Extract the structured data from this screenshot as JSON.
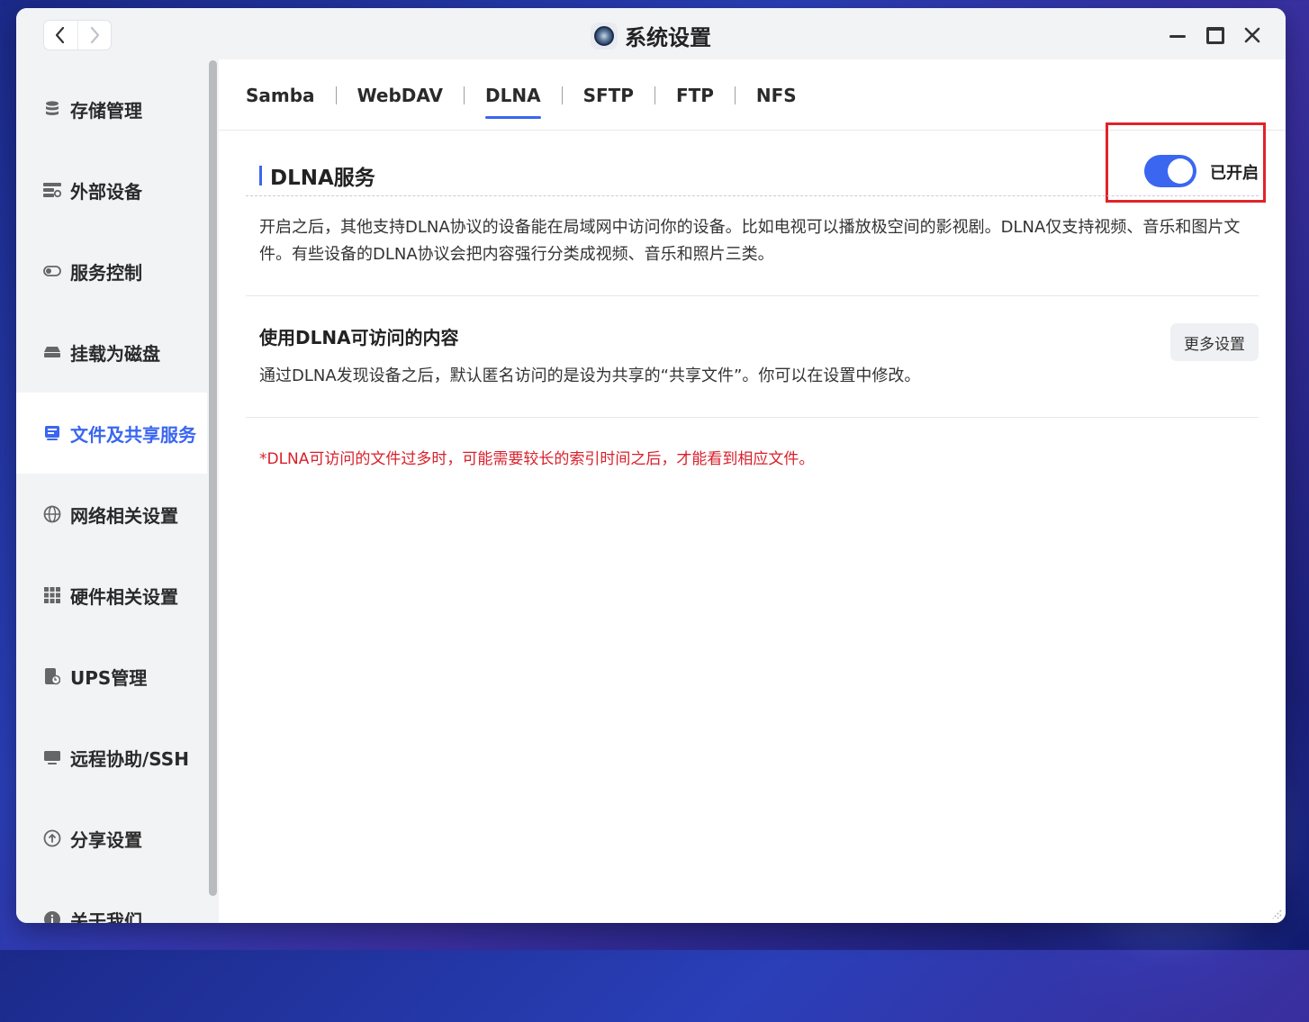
{
  "window": {
    "title": "系统设置"
  },
  "nav": {
    "back_icon": "chevron-left-icon",
    "forward_icon": "chevron-right-icon"
  },
  "sidebar": {
    "items": [
      {
        "label": "存储管理",
        "icon": "database-icon"
      },
      {
        "label": "外部设备",
        "icon": "device-icon"
      },
      {
        "label": "服务控制",
        "icon": "toggle-icon"
      },
      {
        "label": "挂载为磁盘",
        "icon": "drive-icon"
      },
      {
        "label": "文件及共享服务",
        "icon": "file-share-icon",
        "active": true
      },
      {
        "label": "网络相关设置",
        "icon": "globe-icon"
      },
      {
        "label": "硬件相关设置",
        "icon": "grid-icon"
      },
      {
        "label": "UPS管理",
        "icon": "ups-icon"
      },
      {
        "label": "远程协助/SSH",
        "icon": "monitor-icon"
      },
      {
        "label": "分享设置",
        "icon": "share-icon"
      },
      {
        "label": "关于我们",
        "icon": "info-icon"
      }
    ]
  },
  "tabs": [
    {
      "label": "Samba"
    },
    {
      "label": "WebDAV"
    },
    {
      "label": "DLNA",
      "active": true
    },
    {
      "label": "SFTP"
    },
    {
      "label": "FTP"
    },
    {
      "label": "NFS"
    }
  ],
  "dlna": {
    "title": "DLNA服务",
    "toggle_state": "已开启",
    "toggle_on": true,
    "description": "开启之后，其他支持DLNA协议的设备能在局域网中访问你的设备。比如电视可以播放极空间的影视剧。DLNA仅支持视频、音乐和图片文件。有些设备的DLNA协议会把内容强行分类成视频、音乐和照片三类。"
  },
  "content_access": {
    "title": "使用DLNA可访问的内容",
    "description": "通过DLNA发现设备之后，默认匿名访问的是设为共享的“共享文件”。你可以在设置中修改。",
    "more_button": "更多设置"
  },
  "note": "*DLNA可访问的文件过多时，可能需要较长的索引时间之后，才能看到相应文件。",
  "colors": {
    "accent": "#3a66f0",
    "highlight_box": "#e0232a",
    "note_text": "#d9202a"
  }
}
